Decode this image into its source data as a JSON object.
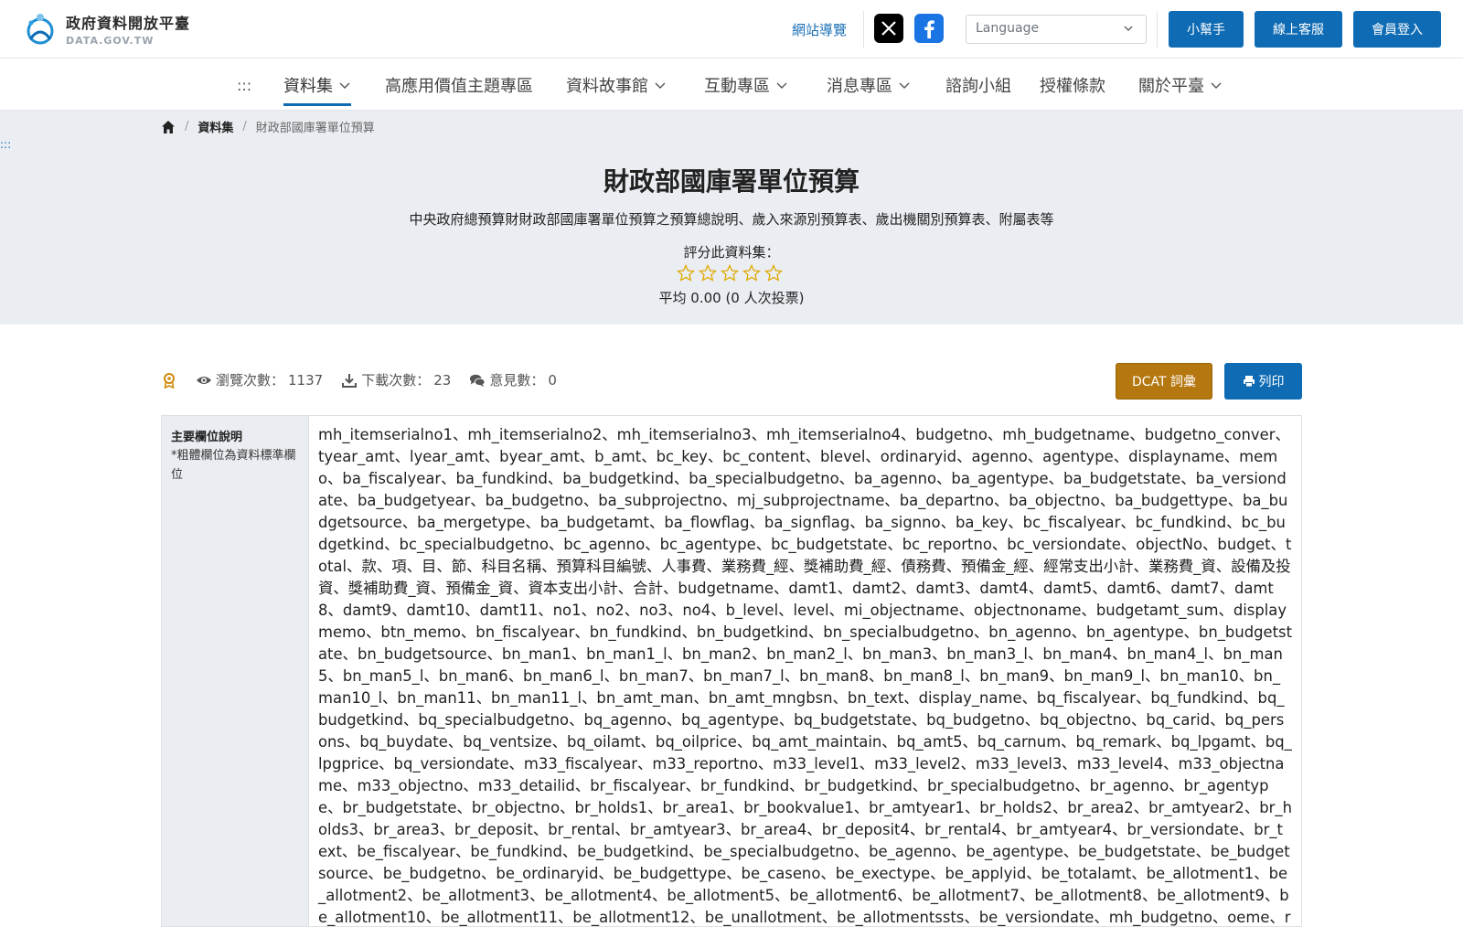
{
  "header": {
    "logo_main": "政府資料開放平臺",
    "logo_sub": "DATA.GOV.TW",
    "sitemap_label": "網站導覽",
    "language_placeholder": "Language",
    "help_label": "小幫手",
    "service_label": "線上客服",
    "login_label": "會員登入"
  },
  "nav": {
    "skip_label": ":::",
    "items": [
      {
        "label": "資料集"
      },
      {
        "label": "高應用價值主題專區"
      },
      {
        "label": "資料故事館"
      },
      {
        "label": "互動專區"
      },
      {
        "label": "消息專區"
      },
      {
        "label": "諮詢小組"
      },
      {
        "label": "授權條款"
      },
      {
        "label": "關於平臺"
      }
    ]
  },
  "breadcrumb": {
    "level1": "資料集",
    "current": "財政部國庫署單位預算"
  },
  "hero": {
    "skip_label": ":::",
    "title": "財政部國庫署單位預算",
    "description": "中央政府總預算財財政部國庫署單位預算之預算總說明、歲入來源別預算表、歲出機關別預算表、附屬表等",
    "rate_label": "評分此資料集：",
    "rating_value": 0,
    "rating_max": 5,
    "average_text": "平均 0.00 (0 人次投票)"
  },
  "stats": {
    "views_label": "瀏覽次數：",
    "views_value": "1137",
    "downloads_label": "下載次數：",
    "downloads_value": "23",
    "comments_label": "意見數：",
    "comments_value": "0"
  },
  "actions": {
    "dcat_label": "DCAT 詞彙",
    "print_label": "列印"
  },
  "fields": {
    "label_title": "主要欄位說明",
    "label_note": "*粗體欄位為資料標準欄位",
    "value": "mh_itemserialno1、mh_itemserialno2、mh_itemserialno3、mh_itemserialno4、budgetno、mh_budgetname、budgetno_conver、tyear_amt、lyear_amt、byear_amt、b_amt、bc_key、bc_content、blevel、ordinaryid、agenno、agentype、displayname、memo、ba_fiscalyear、ba_fundkind、ba_budgetkind、ba_specialbudgetno、ba_agenno、ba_agentype、ba_budgetstate、ba_versiondate、ba_budgetyear、ba_budgetno、ba_subprojectno、mj_subprojectname、ba_departno、ba_objectno、ba_budgettype、ba_budgetsource、ba_mergetype、ba_budgetamt、ba_flowflag、ba_signflag、ba_signno、ba_key、bc_fiscalyear、bc_fundkind、bc_budgetkind、bc_specialbudgetno、bc_agenno、bc_agentype、bc_budgetstate、bc_reportno、bc_versiondate、objectNo、budget、total、款、項、目、節、科目名稱、預算科目編號、人事費、業務費_經、獎補助費_經、債務費、預備金_經、經常支出小計、業務費_資、設備及投資、獎補助費_資、預備金_資、資本支出小計、合計、budgetname、damt1、damt2、damt3、damt4、damt5、damt6、damt7、damt8、damt9、damt10、damt11、no1、no2、no3、no4、b_level、level、mi_objectname、objectnoname、budgetamt_sum、displaymemo、btn_memo、bn_fiscalyear、bn_fundkind、bn_budgetkind、bn_specialbudgetno、bn_agenno、bn_agentype、bn_budgetstate、bn_budgetsource、bn_man1、bn_man1_l、bn_man2、bn_man2_l、bn_man3、bn_man3_l、bn_man4、bn_man4_l、bn_man5、bn_man5_l、bn_man6、bn_man6_l、bn_man7、bn_man7_l、bn_man8、bn_man8_l、bn_man9、bn_man9_l、bn_man10、bn_man10_l、bn_man11、bn_man11_l、bn_amt_man、bn_amt_mngbsn、bn_text、display_name、bq_fiscalyear、bq_fundkind、bq_budgetkind、bq_specialbudgetno、bq_agenno、bq_agentype、bq_budgetstate、bq_budgetno、bq_objectno、bq_carid、bq_persons、bq_buydate、bq_ventsize、bq_oilamt、bq_oilprice、bq_amt_maintain、bq_amt5、bq_carnum、bq_remark、bq_lpgamt、bq_lpgprice、bq_versiondate、m33_fiscalyear、m33_reportno、m33_level1、m33_level2、m33_level3、m33_level4、m33_objectname、m33_objectno、m33_detailid、br_fiscalyear、br_fundkind、br_budgetkind、br_specialbudgetno、br_agenno、br_agentype、br_budgetstate、br_objectno、br_holds1、br_area1、br_bookvalue1、br_amtyear1、br_holds2、br_area2、br_amtyear2、br_holds3、br_area3、br_deposit、br_rental、br_amtyear3、br_area4、br_deposit4、br_rental4、br_amtyear4、br_versiondate、br_text、be_fiscalyear、be_fundkind、be_budgetkind、be_specialbudgetno、be_agenno、be_agentype、be_budgetstate、be_budgetsource、be_budgetno、be_ordinaryid、be_budgettype、be_caseno、be_exectype、be_applyid、be_totalamt、be_allotment1、be_allotment2、be_allotment3、be_allotment4、be_allotment5、be_allotment6、be_allotment7、be_allotment8、be_allotment9、be_allotment10、be_allotment11、be_allotment12、be_unallotment、be_allotmentssts、be_versiondate、mh_budgetno、oeme、reme、bh_fiscalyear、bh_fundkind、bh_budgetkind、bh_specialbudgetno、bh_agenno、bh_"
  },
  "colors": {
    "primary": "#0f6cb4",
    "dcat": "#b5770f",
    "hero_bg": "#eaeef2",
    "star": "#e0a800"
  },
  "icons": [
    "logo-icon",
    "x-icon",
    "facebook-icon",
    "chevron-down-icon",
    "home-icon",
    "award-icon",
    "eye-icon",
    "download-icon",
    "comments-icon",
    "print-icon",
    "star-icon"
  ]
}
